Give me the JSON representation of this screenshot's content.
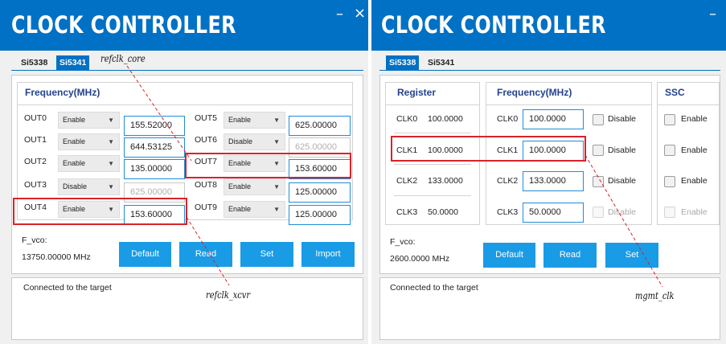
{
  "left": {
    "title": "CLOCK CONTROLLER",
    "minimize": "–",
    "close": "×",
    "tabs": [
      "Si5338",
      "Si5341"
    ],
    "frequency_title": "Frequency(MHz)",
    "outputs": [
      {
        "label": "OUT0",
        "mode": "Enable",
        "value": "155.52000",
        "disabled": false
      },
      {
        "label": "OUT1",
        "mode": "Enable",
        "value": "644.53125",
        "disabled": false
      },
      {
        "label": "OUT2",
        "mode": "Enable",
        "value": "135.00000",
        "disabled": false
      },
      {
        "label": "OUT3",
        "mode": "Disable",
        "value": "625.00000",
        "disabled": true
      },
      {
        "label": "OUT4",
        "mode": "Enable",
        "value": "153.60000",
        "disabled": false
      },
      {
        "label": "OUT5",
        "mode": "Enable",
        "value": "625.00000",
        "disabled": false
      },
      {
        "label": "OUT6",
        "mode": "Disable",
        "value": "625.00000",
        "disabled": true
      },
      {
        "label": "OUT7",
        "mode": "Enable",
        "value": "153.60000",
        "disabled": false
      },
      {
        "label": "OUT8",
        "mode": "Enable",
        "value": "125.00000",
        "disabled": false
      },
      {
        "label": "OUT9",
        "mode": "Enable",
        "value": "125.00000",
        "disabled": false
      }
    ],
    "fvco_label": "F_vco:",
    "fvco_value": "13750.00000 MHz",
    "buttons": {
      "default": "Default",
      "read": "Read",
      "set": "Set",
      "import": "Import"
    },
    "status": "Connected to the target"
  },
  "right": {
    "title": "CLOCK CONTROLLER",
    "minimize": "–",
    "tabs": [
      "Si5338",
      "Si5341"
    ],
    "register_title": "Register",
    "frequency_title": "Frequency(MHz)",
    "ssc_title": "SSC",
    "clocks": [
      {
        "label": "CLK0",
        "register": "100.0000",
        "value": "100.0000",
        "disable": "Disable",
        "disable_dim": false,
        "ssc": "Enable",
        "ssc_dim": false
      },
      {
        "label": "CLK1",
        "register": "100.0000",
        "value": "100.0000",
        "disable": "Disable",
        "disable_dim": false,
        "ssc": "Enable",
        "ssc_dim": false
      },
      {
        "label": "CLK2",
        "register": "133.0000",
        "value": "133.0000",
        "disable": "Disable",
        "disable_dim": false,
        "ssc": "Enable",
        "ssc_dim": false
      },
      {
        "label": "CLK3",
        "register": "50.0000",
        "value": "50.0000",
        "disable": "Disable",
        "disable_dim": true,
        "ssc": "Enable",
        "ssc_dim": true
      }
    ],
    "fvco_label": "F_vco:",
    "fvco_value": "2600.0000 MHz",
    "buttons": {
      "default": "Default",
      "read": "Read",
      "set": "Set"
    },
    "status": "Connected to the target"
  },
  "annotations": {
    "refclk_core": "refclk_core",
    "refclk_xcvr": "refclk_xcvr",
    "mgmt_clk": "mgmt_clk"
  },
  "colors": {
    "title_bar": "#0071c5",
    "button": "#1a9be6",
    "highlight": "#d8232a",
    "group_title": "#25428f"
  }
}
